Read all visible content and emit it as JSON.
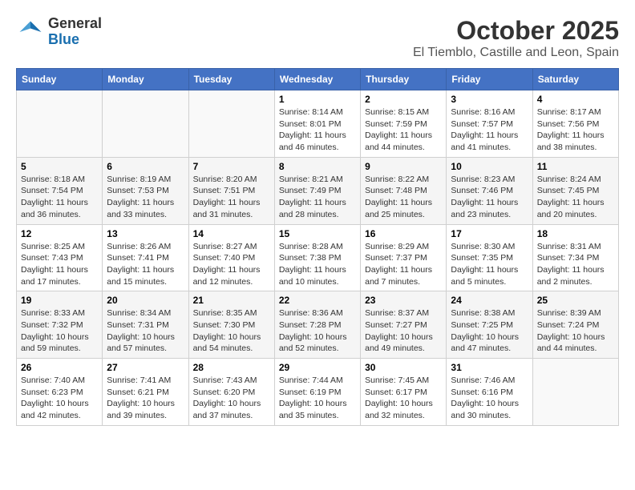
{
  "header": {
    "logo_general": "General",
    "logo_blue": "Blue",
    "main_title": "October 2025",
    "subtitle": "El Tiemblo, Castille and Leon, Spain"
  },
  "calendar": {
    "weekdays": [
      "Sunday",
      "Monday",
      "Tuesday",
      "Wednesday",
      "Thursday",
      "Friday",
      "Saturday"
    ],
    "weeks": [
      [
        {
          "day": "",
          "info": ""
        },
        {
          "day": "",
          "info": ""
        },
        {
          "day": "",
          "info": ""
        },
        {
          "day": "1",
          "info": "Sunrise: 8:14 AM\nSunset: 8:01 PM\nDaylight: 11 hours and 46 minutes."
        },
        {
          "day": "2",
          "info": "Sunrise: 8:15 AM\nSunset: 7:59 PM\nDaylight: 11 hours and 44 minutes."
        },
        {
          "day": "3",
          "info": "Sunrise: 8:16 AM\nSunset: 7:57 PM\nDaylight: 11 hours and 41 minutes."
        },
        {
          "day": "4",
          "info": "Sunrise: 8:17 AM\nSunset: 7:56 PM\nDaylight: 11 hours and 38 minutes."
        }
      ],
      [
        {
          "day": "5",
          "info": "Sunrise: 8:18 AM\nSunset: 7:54 PM\nDaylight: 11 hours and 36 minutes."
        },
        {
          "day": "6",
          "info": "Sunrise: 8:19 AM\nSunset: 7:53 PM\nDaylight: 11 hours and 33 minutes."
        },
        {
          "day": "7",
          "info": "Sunrise: 8:20 AM\nSunset: 7:51 PM\nDaylight: 11 hours and 31 minutes."
        },
        {
          "day": "8",
          "info": "Sunrise: 8:21 AM\nSunset: 7:49 PM\nDaylight: 11 hours and 28 minutes."
        },
        {
          "day": "9",
          "info": "Sunrise: 8:22 AM\nSunset: 7:48 PM\nDaylight: 11 hours and 25 minutes."
        },
        {
          "day": "10",
          "info": "Sunrise: 8:23 AM\nSunset: 7:46 PM\nDaylight: 11 hours and 23 minutes."
        },
        {
          "day": "11",
          "info": "Sunrise: 8:24 AM\nSunset: 7:45 PM\nDaylight: 11 hours and 20 minutes."
        }
      ],
      [
        {
          "day": "12",
          "info": "Sunrise: 8:25 AM\nSunset: 7:43 PM\nDaylight: 11 hours and 17 minutes."
        },
        {
          "day": "13",
          "info": "Sunrise: 8:26 AM\nSunset: 7:41 PM\nDaylight: 11 hours and 15 minutes."
        },
        {
          "day": "14",
          "info": "Sunrise: 8:27 AM\nSunset: 7:40 PM\nDaylight: 11 hours and 12 minutes."
        },
        {
          "day": "15",
          "info": "Sunrise: 8:28 AM\nSunset: 7:38 PM\nDaylight: 11 hours and 10 minutes."
        },
        {
          "day": "16",
          "info": "Sunrise: 8:29 AM\nSunset: 7:37 PM\nDaylight: 11 hours and 7 minutes."
        },
        {
          "day": "17",
          "info": "Sunrise: 8:30 AM\nSunset: 7:35 PM\nDaylight: 11 hours and 5 minutes."
        },
        {
          "day": "18",
          "info": "Sunrise: 8:31 AM\nSunset: 7:34 PM\nDaylight: 11 hours and 2 minutes."
        }
      ],
      [
        {
          "day": "19",
          "info": "Sunrise: 8:33 AM\nSunset: 7:32 PM\nDaylight: 10 hours and 59 minutes."
        },
        {
          "day": "20",
          "info": "Sunrise: 8:34 AM\nSunset: 7:31 PM\nDaylight: 10 hours and 57 minutes."
        },
        {
          "day": "21",
          "info": "Sunrise: 8:35 AM\nSunset: 7:30 PM\nDaylight: 10 hours and 54 minutes."
        },
        {
          "day": "22",
          "info": "Sunrise: 8:36 AM\nSunset: 7:28 PM\nDaylight: 10 hours and 52 minutes."
        },
        {
          "day": "23",
          "info": "Sunrise: 8:37 AM\nSunset: 7:27 PM\nDaylight: 10 hours and 49 minutes."
        },
        {
          "day": "24",
          "info": "Sunrise: 8:38 AM\nSunset: 7:25 PM\nDaylight: 10 hours and 47 minutes."
        },
        {
          "day": "25",
          "info": "Sunrise: 8:39 AM\nSunset: 7:24 PM\nDaylight: 10 hours and 44 minutes."
        }
      ],
      [
        {
          "day": "26",
          "info": "Sunrise: 7:40 AM\nSunset: 6:23 PM\nDaylight: 10 hours and 42 minutes."
        },
        {
          "day": "27",
          "info": "Sunrise: 7:41 AM\nSunset: 6:21 PM\nDaylight: 10 hours and 39 minutes."
        },
        {
          "day": "28",
          "info": "Sunrise: 7:43 AM\nSunset: 6:20 PM\nDaylight: 10 hours and 37 minutes."
        },
        {
          "day": "29",
          "info": "Sunrise: 7:44 AM\nSunset: 6:19 PM\nDaylight: 10 hours and 35 minutes."
        },
        {
          "day": "30",
          "info": "Sunrise: 7:45 AM\nSunset: 6:17 PM\nDaylight: 10 hours and 32 minutes."
        },
        {
          "day": "31",
          "info": "Sunrise: 7:46 AM\nSunset: 6:16 PM\nDaylight: 10 hours and 30 minutes."
        },
        {
          "day": "",
          "info": ""
        }
      ]
    ]
  }
}
